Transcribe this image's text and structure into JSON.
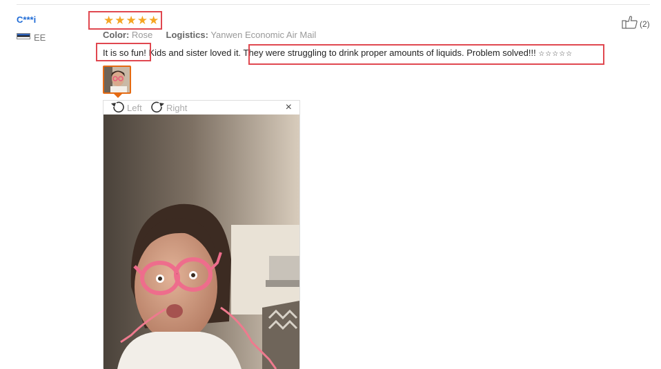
{
  "reviewer": {
    "name": "C***i",
    "country": "EE",
    "flag_icon": "estonia-flag-icon"
  },
  "rating": {
    "stars": 5,
    "max": 5,
    "color": "#f5a623"
  },
  "meta": {
    "color_label": "Color:",
    "color_value": "Rose",
    "logistics_label": "Logistics:",
    "logistics_value": "Yanwen Economic Air Mail"
  },
  "review": {
    "part1": "It is so fun!",
    "part2": " Kids and sister loved it. ",
    "part3": "They were struggling to drink proper amounts of liquids. Problem solved!!! ",
    "stars_text": "☆☆☆☆☆"
  },
  "like": {
    "icon": "thumbs-up-icon",
    "count": "(2)"
  },
  "viewer": {
    "rotate_left": "Left",
    "rotate_right": "Right",
    "close": "×"
  },
  "highlight_color": "#e0474f"
}
